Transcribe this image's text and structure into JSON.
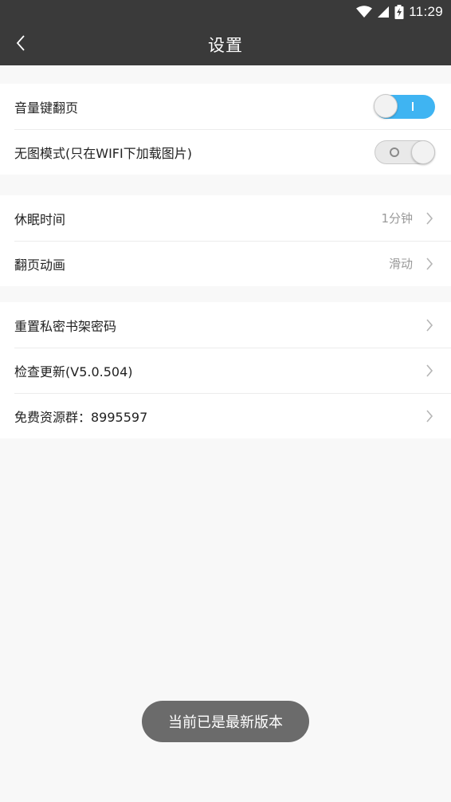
{
  "status_bar": {
    "time": "11:29",
    "icons": [
      "wifi-icon",
      "cell-signal-icon",
      "battery-charging-icon"
    ]
  },
  "header": {
    "title": "设置",
    "back_icon": "chevron-left-icon"
  },
  "sections": [
    {
      "items": [
        {
          "label": "音量键翻页",
          "control": "toggle",
          "on": true
        },
        {
          "label": "无图模式(只在WIFI下加载图片)",
          "control": "toggle",
          "on": false
        }
      ]
    },
    {
      "items": [
        {
          "label": "休眠时间",
          "value": "1分钟",
          "control": "chevron"
        },
        {
          "label": "翻页动画",
          "value": "滑动",
          "control": "chevron"
        }
      ]
    },
    {
      "items": [
        {
          "label": "重置私密书架密码",
          "control": "chevron"
        },
        {
          "label": "检查更新(V5.0.504)",
          "control": "chevron"
        },
        {
          "label": "免费资源群：8995597",
          "control": "chevron"
        }
      ]
    }
  ],
  "toast": {
    "text": "当前已是最新版本"
  },
  "colors": {
    "header_bg": "#3a3a3a",
    "toggle_on": "#3fb4f2",
    "page_bg": "#f8f8f8",
    "toast_bg": "#6b6b6b"
  }
}
